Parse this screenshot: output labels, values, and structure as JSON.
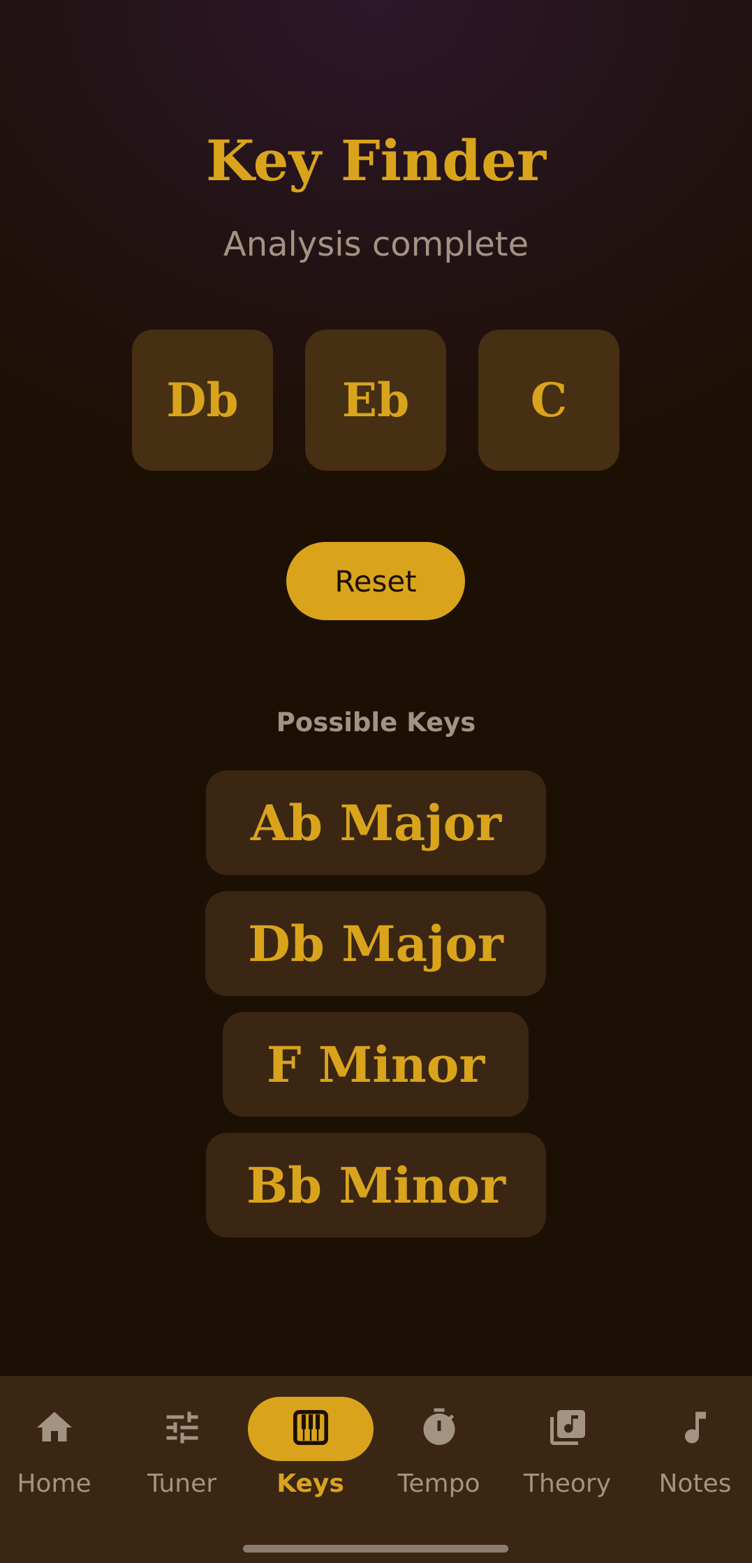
{
  "header": {
    "title": "Key Finder",
    "subtitle": "Analysis complete"
  },
  "selected_notes": [
    "Db",
    "Eb",
    "C"
  ],
  "reset_label": "Reset",
  "possible_keys": {
    "label": "Possible Keys",
    "items": [
      "Ab Major",
      "Db Major",
      "F Minor",
      "Bb Minor"
    ]
  },
  "nav": {
    "items": [
      {
        "label": "Home",
        "icon": "home-icon"
      },
      {
        "label": "Tuner",
        "icon": "sliders-icon"
      },
      {
        "label": "Keys",
        "icon": "piano-icon",
        "active": true
      },
      {
        "label": "Tempo",
        "icon": "stopwatch-icon"
      },
      {
        "label": "Theory",
        "icon": "music-library-icon"
      },
      {
        "label": "Notes",
        "icon": "music-note-icon"
      }
    ]
  },
  "colors": {
    "accent": "#d9a41c",
    "background": "#1c0f03",
    "surface": "#3b2613",
    "muted_text": "#a39383"
  }
}
